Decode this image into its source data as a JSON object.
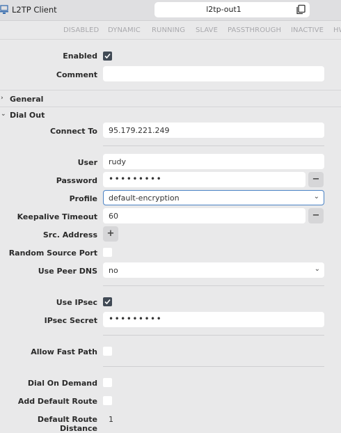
{
  "window": {
    "title": "L2TP Client",
    "name": "l2tp-out1"
  },
  "flags": [
    "DISABLED",
    "DYNAMIC",
    "RUNNING",
    "SLAVE",
    "PASSTHROUGH",
    "INACTIVE",
    "HW"
  ],
  "form": {
    "enabled_label": "Enabled",
    "enabled_checked": true,
    "comment_label": "Comment",
    "comment_value": "",
    "general_label": "General",
    "dialout_label": "Dial Out",
    "connect_to_label": "Connect To",
    "connect_to_value": "95.179.221.249",
    "user_label": "User",
    "user_value": "rudy",
    "password_label": "Password",
    "password_value": "•••••••••",
    "profile_label": "Profile",
    "profile_value": "default-encryption",
    "keepalive_label": "Keepalive Timeout",
    "keepalive_value": "60",
    "src_address_label": "Src. Address",
    "random_source_port_label": "Random Source Port",
    "random_source_port_checked": false,
    "use_peer_dns_label": "Use Peer DNS",
    "use_peer_dns_value": "no",
    "use_ipsec_label": "Use IPsec",
    "use_ipsec_checked": true,
    "ipsec_secret_label": "IPsec Secret",
    "ipsec_secret_value": "•••••••••",
    "allow_fast_path_label": "Allow Fast Path",
    "allow_fast_path_checked": false,
    "dial_on_demand_label": "Dial On Demand",
    "dial_on_demand_checked": false,
    "add_default_route_label": "Add Default Route",
    "add_default_route_checked": false,
    "default_route_distance_label": "Default Route Distance",
    "default_route_distance_value": "1"
  },
  "icons": {
    "window": "network-interface-icon",
    "copy": "copy-icon",
    "remove": "minus",
    "add": "plus",
    "collapsed": "chevron-right",
    "expanded": "chevron-down"
  },
  "colors": {
    "accent": "#4a82c4",
    "checkbox_checked": "#414a55",
    "flag_text": "#a9a9ad"
  }
}
